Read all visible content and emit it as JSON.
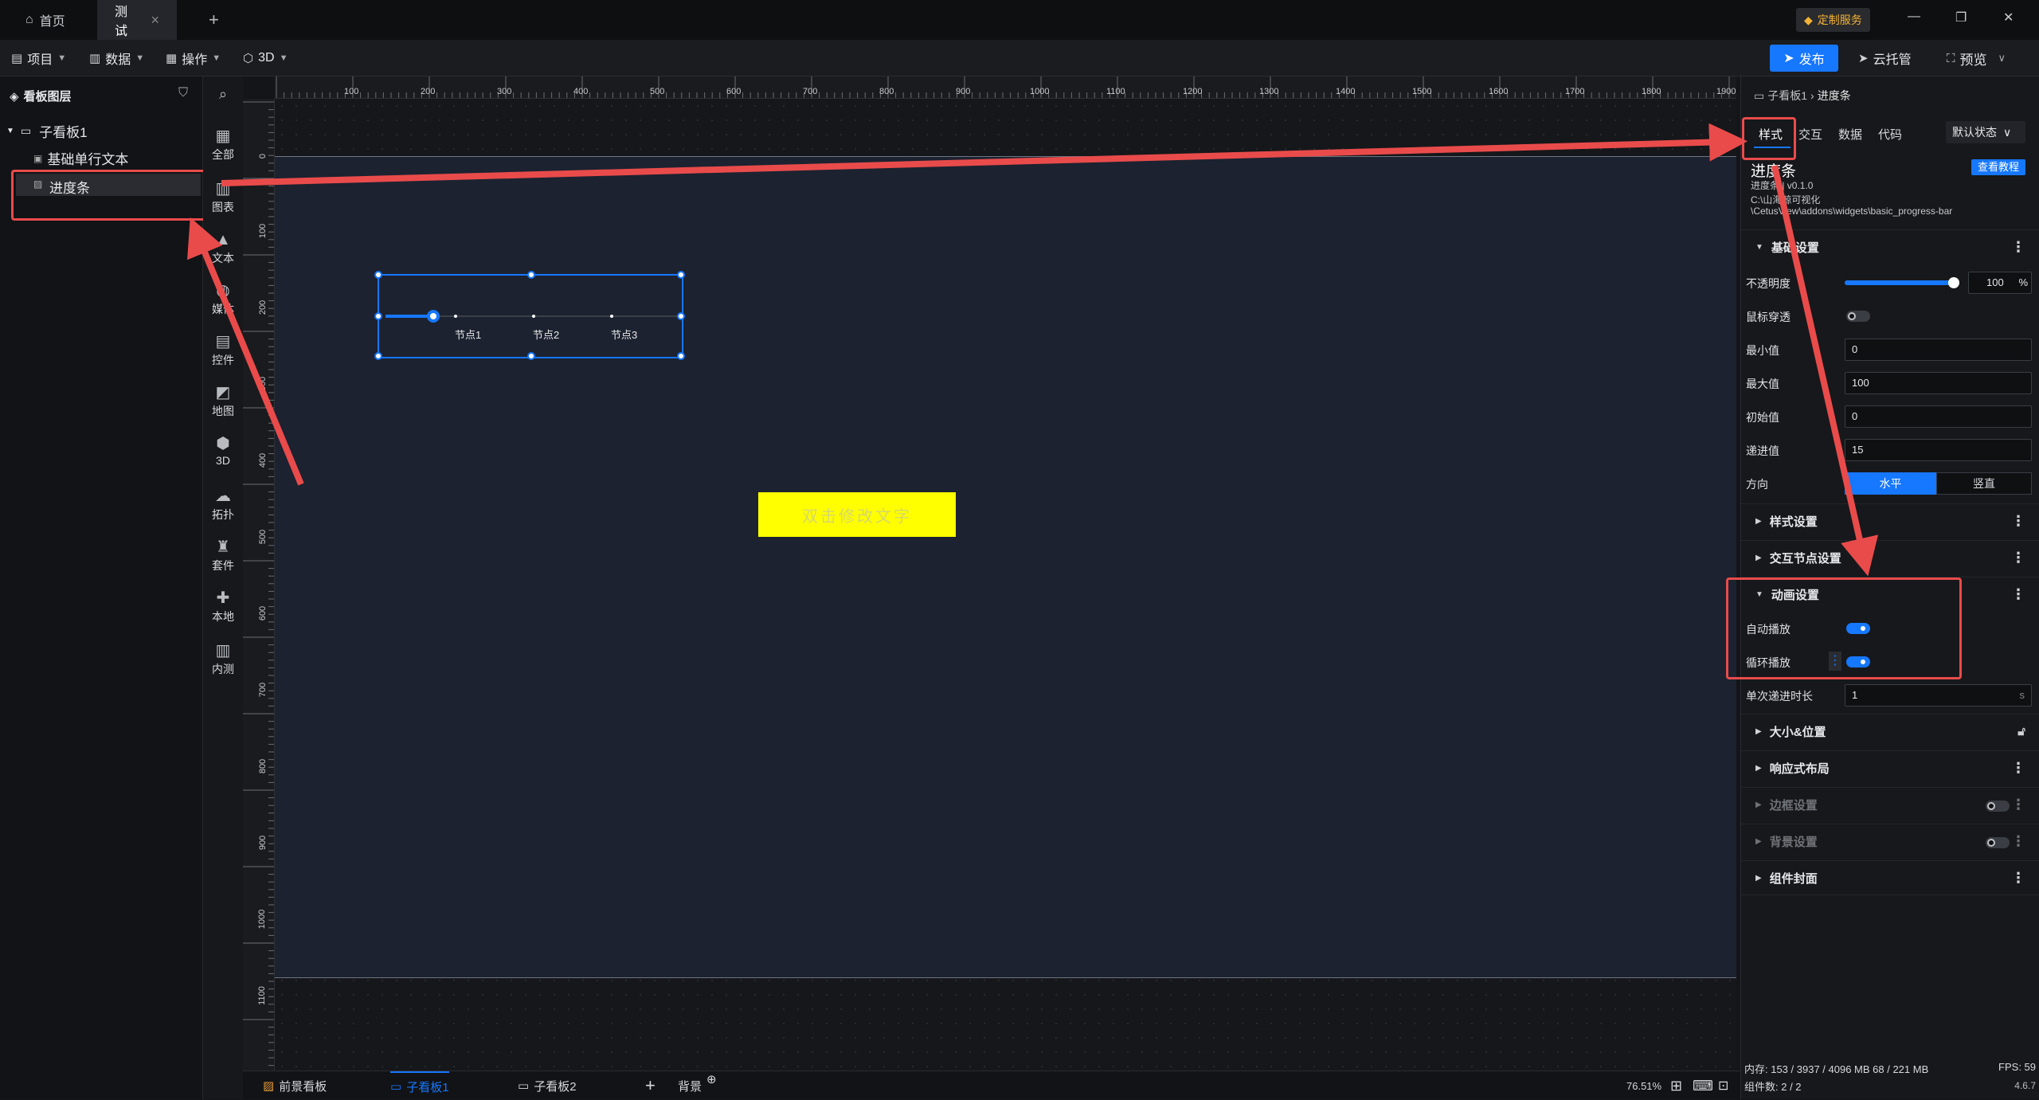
{
  "titlebar": {
    "tabs": [
      {
        "label": "首页",
        "icon": "home-icon"
      },
      {
        "label": "测试",
        "close": "×"
      }
    ],
    "add_tab": "+",
    "custom_service": "定制服务",
    "win_minimize": "—",
    "win_restore": "❐",
    "win_close": "✕"
  },
  "toolbar": {
    "menus": [
      "项目",
      "数据",
      "操作",
      "3D"
    ],
    "publish": "发布",
    "cloud_host": "云托管",
    "preview": "预览"
  },
  "layers": {
    "title": "看板图层",
    "root": "子看板1",
    "items": [
      "基础单行文本",
      "进度条"
    ]
  },
  "iconbar": {
    "items": [
      "全部",
      "图表",
      "文本",
      "媒体",
      "控件",
      "地图",
      "3D",
      "拓扑",
      "套件",
      "本地",
      "内测"
    ]
  },
  "ruler": {
    "h_ticks": [
      "100",
      "200",
      "300",
      "400",
      "500",
      "600",
      "700",
      "800",
      "900",
      "1000",
      "1100",
      "1200",
      "1300",
      "1400",
      "1500",
      "1600",
      "1700",
      "1800",
      "1900"
    ],
    "v_ticks": [
      "0",
      "100",
      "200",
      "300",
      "400",
      "500",
      "600",
      "700",
      "800",
      "900",
      "1000",
      "1100"
    ]
  },
  "canvas": {
    "progress_nodes": [
      "节点1",
      "节点2",
      "节点3"
    ],
    "text_widget": "双击修改文字"
  },
  "props": {
    "breadcrumb_parent": "子看板1",
    "breadcrumb_current": "进度条",
    "tabs": [
      "样式",
      "交互",
      "数据",
      "代码"
    ],
    "state_select": "默认状态",
    "widget_name": "进度条",
    "widget_version": "进度条 | v0.1.0",
    "widget_path_1": "C:\\山海鲸可视化",
    "widget_path_2": "\\CetusView\\addons\\widgets\\basic_progress-bar",
    "tutorial": "查看教程",
    "basic_section": "基础设置",
    "opacity_label": "不透明度",
    "opacity_value": "100",
    "opacity_unit": "%",
    "opacity_fraction": 1.0,
    "mouse_through": "鼠标穿透",
    "min_label": "最小值",
    "min_value": "0",
    "max_label": "最大值",
    "max_value": "100",
    "init_label": "初始值",
    "init_value": "0",
    "step_label": "递进值",
    "step_value": "15",
    "direction_label": "方向",
    "dir_h": "水平",
    "dir_v": "竖直",
    "style_section": "样式设置",
    "node_section": "交互节点设置",
    "anim_section": "动画设置",
    "autoplay": "自动播放",
    "loop": "循环播放",
    "duration_label": "单次递进时长",
    "duration_value": "1",
    "duration_unit": "s",
    "size_section": "大小&位置",
    "responsive_section": "响应式布局",
    "border_section": "边框设置",
    "bg_section": "背景设置",
    "cover_section": "组件封面"
  },
  "bottombar": {
    "tabs": [
      "前景看板",
      "子看板1",
      "子看板2"
    ],
    "bg_label": "背景",
    "zoom": "76.51%"
  },
  "status": {
    "memory": "内存: 153 / 3937 / 4096 MB  68 / 221 MB",
    "fps": "FPS: 59",
    "components": "组件数: 2 / 2",
    "version": "4.6.7"
  }
}
